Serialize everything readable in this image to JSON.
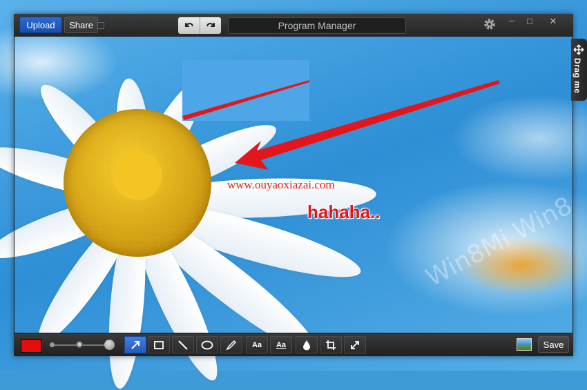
{
  "titlebar": {
    "upload_label": "Upload",
    "share_label": "Share",
    "window_title": "Program Manager"
  },
  "drag_tab": {
    "label": "Drag me"
  },
  "annotations": {
    "url_text": "www.ouyaoxiazai.com",
    "haha_text": "hahaha..",
    "arrow_color": "#e3171b"
  },
  "toolbar": {
    "color_swatch": "#e80c0c",
    "tools": [
      {
        "name": "arrow-tool",
        "icon": "arrow-icon",
        "active": true
      },
      {
        "name": "rectangle-tool",
        "icon": "rectangle-icon",
        "active": false
      },
      {
        "name": "line-tool",
        "icon": "line-icon",
        "active": false
      },
      {
        "name": "ellipse-tool",
        "icon": "ellipse-icon",
        "active": false
      },
      {
        "name": "pen-tool",
        "icon": "pen-icon",
        "active": false
      },
      {
        "name": "text-tool",
        "icon": "text-icon",
        "label": "Aa",
        "active": false
      },
      {
        "name": "text-style-tool",
        "icon": "text-style-icon",
        "label": "Aa",
        "active": false
      },
      {
        "name": "blur-tool",
        "icon": "drop-icon",
        "active": false
      },
      {
        "name": "crop-tool",
        "icon": "crop-icon",
        "active": false
      },
      {
        "name": "resize-tool",
        "icon": "resize-icon",
        "active": false
      }
    ],
    "save_label": "Save"
  },
  "watermark": "Win8Mi Win8"
}
